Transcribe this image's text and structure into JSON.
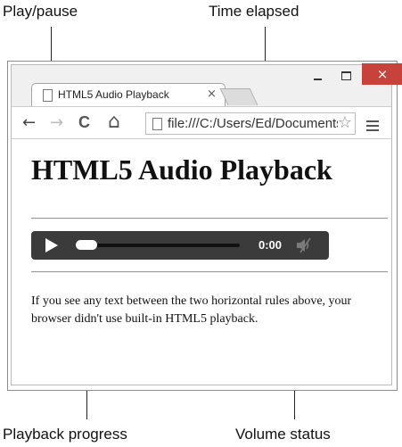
{
  "callouts": {
    "play_pause": "Play/pause",
    "time_elapsed": "Time elapsed",
    "playback_progress": "Playback progress",
    "volume_status": "Volume status"
  },
  "window": {
    "minimize_glyph": "_",
    "close_glyph": "×"
  },
  "tab": {
    "title": "HTML5 Audio Playback",
    "close_glyph": "×"
  },
  "toolbar": {
    "back_glyph": "←",
    "forward_glyph": "→",
    "reload_glyph": "C",
    "home_glyph": "⌂",
    "url": "file:///C:/Users/Ed/Documents/",
    "star_glyph": "☆"
  },
  "page": {
    "heading": "HTML5 Audio Playback",
    "paragraph": "If you see any text between the two horizontal rules above, your browser didn't use built-in HTML5 playback."
  },
  "player": {
    "time": "0:00",
    "progress_fraction": 0,
    "volume_icon": "speaker-muted-icon"
  },
  "colors": {
    "close_button": "#c8423c",
    "player_bg": "#3b3b3b"
  }
}
